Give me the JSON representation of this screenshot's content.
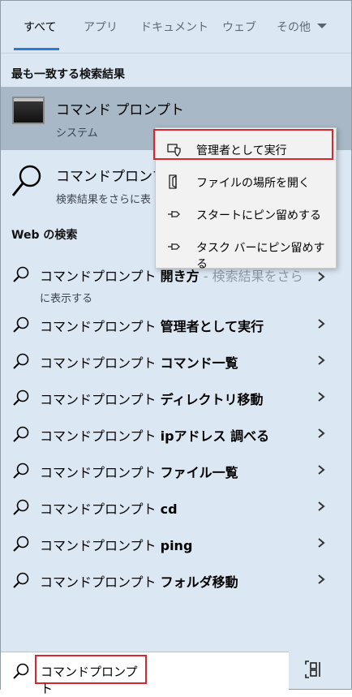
{
  "tabs": [
    {
      "label": "すべて"
    },
    {
      "label": "アプリ"
    },
    {
      "label": "ドキュメント"
    },
    {
      "label": "ウェブ"
    },
    {
      "label": "その他"
    }
  ],
  "best_match": {
    "heading": "最も一致する検索結果",
    "title": "コマンド プロンプト",
    "subtitle": "システム"
  },
  "second_result": {
    "title": "コマンドプロンプト",
    "subtitle": "検索結果をさらに表"
  },
  "web_search": {
    "heading": "Web の検索",
    "rows": [
      {
        "query": "コマンドプロンプト ",
        "bold": "開き方",
        "gray": " - 検索結果をさら",
        "sub": "に表示する"
      },
      {
        "query": "コマンドプロンプト ",
        "bold": "管理者として実行"
      },
      {
        "query": "コマンドプロンプト ",
        "bold": "コマンド一覧"
      },
      {
        "query": "コマンドプロンプト ",
        "bold": "ディレクトリ移動"
      },
      {
        "query": "コマンドプロンプト ",
        "bold": "ipアドレス 調べる"
      },
      {
        "query": "コマンドプロンプト ",
        "bold": "ファイル一覧"
      },
      {
        "query": "コマンドプロンプト ",
        "bold": "cd"
      },
      {
        "query": "コマンドプロンプト ",
        "bold": "ping"
      },
      {
        "query": "コマンドプロンプト ",
        "bold": "フォルダ移動"
      }
    ]
  },
  "context_menu": {
    "items": [
      {
        "label": "管理者として実行",
        "icon": "shield-run-icon"
      },
      {
        "label": "ファイルの場所を開く",
        "icon": "file-location-icon"
      },
      {
        "label": "スタートにピン留めする",
        "icon": "pin-icon"
      },
      {
        "label": "タスク バーにピン留めする",
        "icon": "pin-icon"
      }
    ]
  },
  "search_bar": {
    "value": "コマンドプロンプト"
  },
  "colors": {
    "background": "#dbe7f3",
    "selected_row": "#a8b8c6",
    "accent": "#2a7ad1",
    "highlight_box": "#d9262d"
  }
}
